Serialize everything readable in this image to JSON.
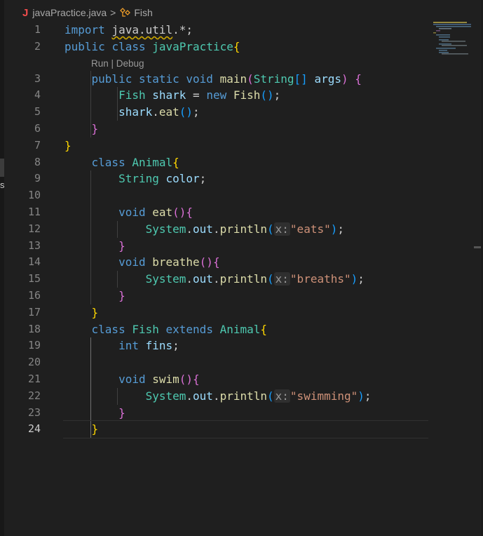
{
  "breadcrumb": {
    "file_icon": "J",
    "file_name": "javaPractice.java",
    "separator": ">",
    "symbol_name": "Fish",
    "symbol_icon": "class-icon"
  },
  "codelens": "Run | Debug",
  "sidebar_fragment": "s",
  "active_line": 24,
  "lines": [
    {
      "n": "1",
      "parts": [
        [
          "kw",
          "import"
        ],
        [
          "pun",
          " "
        ],
        [
          "warn",
          "java.util"
        ],
        [
          "pun",
          ".*;"
        ]
      ]
    },
    {
      "n": "2",
      "parts": [
        [
          "kw",
          "public"
        ],
        [
          "pun",
          " "
        ],
        [
          "kw",
          "class"
        ],
        [
          "pun",
          " "
        ],
        [
          "ty",
          "javaPractice"
        ],
        [
          "b1",
          "{"
        ]
      ]
    },
    {
      "n": "3",
      "parts": [
        [
          "pun",
          "    "
        ],
        [
          "kw",
          "public"
        ],
        [
          "pun",
          " "
        ],
        [
          "kw",
          "static"
        ],
        [
          "pun",
          " "
        ],
        [
          "kw",
          "void"
        ],
        [
          "pun",
          " "
        ],
        [
          "fn",
          "main"
        ],
        [
          "b2",
          "("
        ],
        [
          "ty",
          "String"
        ],
        [
          "b3",
          "[]"
        ],
        [
          "pun",
          " "
        ],
        [
          "var",
          "args"
        ],
        [
          "b2",
          ")"
        ],
        [
          "pun",
          " "
        ],
        [
          "b2",
          "{"
        ]
      ]
    },
    {
      "n": "4",
      "parts": [
        [
          "pun",
          "        "
        ],
        [
          "ty",
          "Fish"
        ],
        [
          "pun",
          " "
        ],
        [
          "var",
          "shark"
        ],
        [
          "pun",
          " = "
        ],
        [
          "kw",
          "new"
        ],
        [
          "pun",
          " "
        ],
        [
          "fn",
          "Fish"
        ],
        [
          "b3",
          "()"
        ],
        [
          "pun",
          ";"
        ]
      ]
    },
    {
      "n": "5",
      "parts": [
        [
          "pun",
          "        "
        ],
        [
          "var",
          "shark"
        ],
        [
          "pun",
          "."
        ],
        [
          "fn",
          "eat"
        ],
        [
          "b3",
          "()"
        ],
        [
          "pun",
          ";"
        ]
      ]
    },
    {
      "n": "6",
      "parts": [
        [
          "pun",
          "    "
        ],
        [
          "b2",
          "}"
        ]
      ]
    },
    {
      "n": "7",
      "parts": [
        [
          "b1",
          "}"
        ]
      ]
    },
    {
      "n": "8",
      "parts": [
        [
          "pun",
          "    "
        ],
        [
          "kw",
          "class"
        ],
        [
          "pun",
          " "
        ],
        [
          "ty",
          "Animal"
        ],
        [
          "b1",
          "{"
        ]
      ]
    },
    {
      "n": "9",
      "parts": [
        [
          "pun",
          "        "
        ],
        [
          "ty",
          "String"
        ],
        [
          "pun",
          " "
        ],
        [
          "var",
          "color"
        ],
        [
          "pun",
          ";"
        ]
      ]
    },
    {
      "n": "10",
      "parts": []
    },
    {
      "n": "11",
      "parts": [
        [
          "pun",
          "        "
        ],
        [
          "kw",
          "void"
        ],
        [
          "pun",
          " "
        ],
        [
          "fn",
          "eat"
        ],
        [
          "b2",
          "(){"
        ]
      ]
    },
    {
      "n": "12",
      "parts": [
        [
          "pun",
          "            "
        ],
        [
          "ty",
          "System"
        ],
        [
          "pun",
          "."
        ],
        [
          "var",
          "out"
        ],
        [
          "pun",
          "."
        ],
        [
          "fn",
          "println"
        ],
        [
          "b3",
          "("
        ],
        [
          "hint",
          "x:"
        ],
        [
          "str",
          "\"eats\""
        ],
        [
          "b3",
          ")"
        ],
        [
          "pun",
          ";"
        ]
      ]
    },
    {
      "n": "13",
      "parts": [
        [
          "pun",
          "        "
        ],
        [
          "b2",
          "}"
        ]
      ]
    },
    {
      "n": "14",
      "parts": [
        [
          "pun",
          "        "
        ],
        [
          "kw",
          "void"
        ],
        [
          "pun",
          " "
        ],
        [
          "fn",
          "breathe"
        ],
        [
          "b2",
          "(){"
        ]
      ]
    },
    {
      "n": "15",
      "parts": [
        [
          "pun",
          "            "
        ],
        [
          "ty",
          "System"
        ],
        [
          "pun",
          "."
        ],
        [
          "var",
          "out"
        ],
        [
          "pun",
          "."
        ],
        [
          "fn",
          "println"
        ],
        [
          "b3",
          "("
        ],
        [
          "hint",
          "x:"
        ],
        [
          "str",
          "\"breaths\""
        ],
        [
          "b3",
          ")"
        ],
        [
          "pun",
          ";"
        ]
      ]
    },
    {
      "n": "16",
      "parts": [
        [
          "pun",
          "        "
        ],
        [
          "b2",
          "}"
        ]
      ]
    },
    {
      "n": "17",
      "parts": [
        [
          "pun",
          "    "
        ],
        [
          "b1",
          "}"
        ]
      ]
    },
    {
      "n": "18",
      "parts": [
        [
          "pun",
          "    "
        ],
        [
          "kw",
          "class"
        ],
        [
          "pun",
          " "
        ],
        [
          "ty",
          "Fish"
        ],
        [
          "pun",
          " "
        ],
        [
          "kw",
          "extends"
        ],
        [
          "pun",
          " "
        ],
        [
          "ty",
          "Animal"
        ],
        [
          "b1",
          "{"
        ]
      ]
    },
    {
      "n": "19",
      "parts": [
        [
          "pun",
          "        "
        ],
        [
          "kw",
          "int"
        ],
        [
          "pun",
          " "
        ],
        [
          "var",
          "fins"
        ],
        [
          "pun",
          ";"
        ]
      ]
    },
    {
      "n": "20",
      "parts": []
    },
    {
      "n": "21",
      "parts": [
        [
          "pun",
          "        "
        ],
        [
          "kw",
          "void"
        ],
        [
          "pun",
          " "
        ],
        [
          "fn",
          "swim"
        ],
        [
          "b2",
          "(){"
        ]
      ]
    },
    {
      "n": "22",
      "parts": [
        [
          "pun",
          "            "
        ],
        [
          "ty",
          "System"
        ],
        [
          "pun",
          "."
        ],
        [
          "var",
          "out"
        ],
        [
          "pun",
          "."
        ],
        [
          "fn",
          "println"
        ],
        [
          "b3",
          "("
        ],
        [
          "hint",
          "x:"
        ],
        [
          "str",
          "\"swimming\""
        ],
        [
          "b3",
          ")"
        ],
        [
          "pun",
          ";"
        ]
      ]
    },
    {
      "n": "23",
      "parts": [
        [
          "pun",
          "        "
        ],
        [
          "b2",
          "}"
        ]
      ]
    },
    {
      "n": "24",
      "parts": [
        [
          "pun",
          "    "
        ],
        [
          "b1",
          "}"
        ]
      ]
    }
  ],
  "colors": {
    "background": "#1f1f1f",
    "keyword": "#569cd6",
    "type": "#4ec9b0",
    "function": "#dcdcaa",
    "variable": "#9cdcfe",
    "string": "#ce9178",
    "bracket_gold": "#ffd700",
    "bracket_purple": "#da70d6",
    "bracket_blue": "#179fff",
    "java_icon": "#f14c4c"
  }
}
